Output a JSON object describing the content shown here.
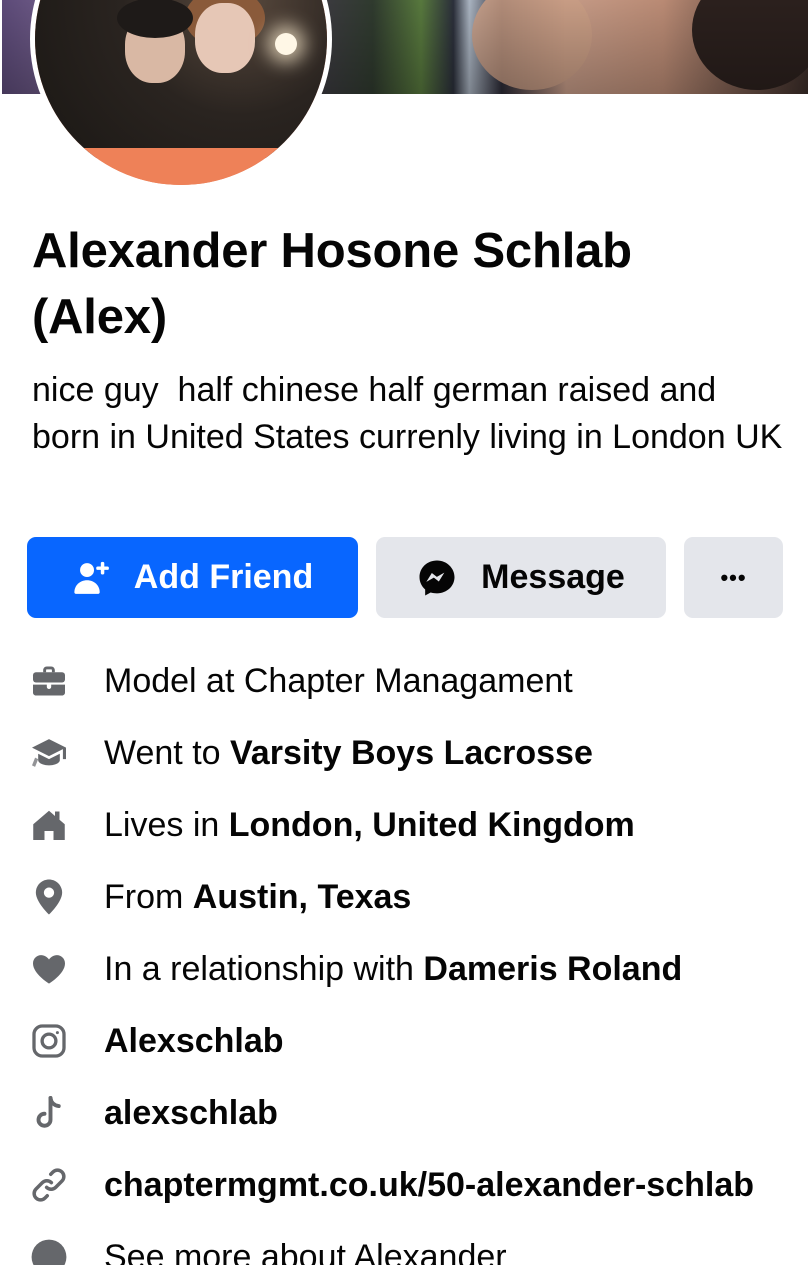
{
  "profile": {
    "name": "Alexander Hosone Schlab (Alex)",
    "bio": "nice guy  half chinese half german raised and born in United States currenly living in London UK"
  },
  "actions": {
    "add_friend_label": "Add Friend",
    "message_label": "Message",
    "more_label": "•••"
  },
  "details": [
    {
      "icon": "briefcase-icon",
      "prefix": "Model at Chapter Managament",
      "bold": ""
    },
    {
      "icon": "graduation-cap-icon",
      "prefix": "Went to ",
      "bold": "Varsity Boys Lacrosse"
    },
    {
      "icon": "home-icon",
      "prefix": "Lives in ",
      "bold": "London, United Kingdom"
    },
    {
      "icon": "location-pin-icon",
      "prefix": "From ",
      "bold": "Austin, Texas"
    },
    {
      "icon": "heart-icon",
      "prefix": "In a relationship with ",
      "bold": "Dameris Roland"
    },
    {
      "icon": "instagram-icon",
      "prefix": "",
      "bold": "Alexschlab"
    },
    {
      "icon": "tiktok-icon",
      "prefix": "",
      "bold": "alexschlab"
    },
    {
      "icon": "link-icon",
      "prefix": "",
      "bold": "chaptermgmt.co.uk/50-alexander-schlab"
    },
    {
      "icon": "more-about-icon",
      "prefix": "See more about Alexander",
      "bold": ""
    }
  ],
  "colors": {
    "primary": "#0866ff",
    "secondary_button": "#e4e6eb",
    "icon_gray": "#65676b",
    "text": "#050505"
  }
}
